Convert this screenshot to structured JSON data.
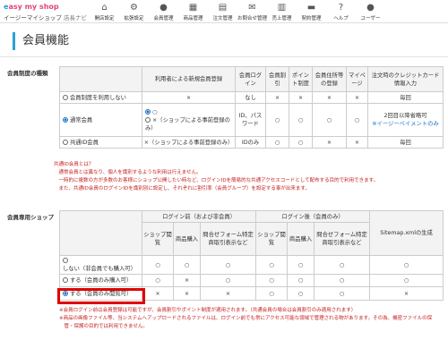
{
  "header": {
    "brand": "easy my shop",
    "brand_prefix": "e",
    "brand_rest": "asy my shop",
    "subtitle": "イージーマイショップ",
    "subtitle_shop": "店長ナビ",
    "nav": [
      {
        "icon": "home-icon",
        "glyph": "⌂",
        "label": "開店設定"
      },
      {
        "icon": "gear-icon",
        "glyph": "⚙",
        "label": "拡張設定"
      },
      {
        "icon": "user-icon",
        "glyph": "●",
        "label": "会員管理"
      },
      {
        "icon": "shop-icon",
        "glyph": "▦",
        "label": "商品管理"
      },
      {
        "icon": "document-icon",
        "glyph": "▤",
        "label": "注文管理"
      },
      {
        "icon": "mail-icon",
        "glyph": "✉",
        "label": "お問合せ管理"
      },
      {
        "icon": "chart-icon",
        "glyph": "▥",
        "label": "売上管理"
      },
      {
        "icon": "book-icon",
        "glyph": "▬",
        "label": "契約管理"
      },
      {
        "icon": "help-icon",
        "glyph": "?",
        "label": "ヘルプ"
      },
      {
        "icon": "user-menu-icon",
        "glyph": "●",
        "label": "ユーザー"
      }
    ]
  },
  "page_title": "会員機能",
  "section1": {
    "label": "会員制度の種類",
    "headers": [
      "利用者による新規会員登録",
      "会員ログイン",
      "会員割引",
      "ポイント制度",
      "会員住所等の登録",
      "マイページ",
      "注文時のクレジットカード情報入力"
    ],
    "rows": [
      {
        "name": "会員制度を利用しない",
        "checked": false,
        "cells": [
          "×",
          "なし",
          "×",
          "×",
          "×",
          "×",
          "毎回"
        ]
      },
      {
        "name": "通常会員",
        "checked": true,
        "reg_a": "○",
        "reg_b": "×（ショップによる事前登録のみ）",
        "cells": [
          "ID、パスワード",
          "○",
          "○",
          "○",
          "○"
        ],
        "credit_a": "2回目以降省略可",
        "credit_b": "※イージーペイメントのみ"
      },
      {
        "name": "共通ID会員",
        "checked": false,
        "cells": [
          "×（ショップによる事前登録のみ）",
          "IDのみ",
          "○",
          "○",
          "×",
          "×",
          "毎回"
        ]
      }
    ],
    "notes": [
      "共通ID会員とは？",
      "　通常会員とは異なり、個人を識別するような利用は行えません。",
      "　一時的に複数の方が多数のお客様にショップ公開したい時など、ログインIDを簡易的な共通アクセスコードとして配布する目的で利用できます。",
      "　また、共通ID会員のログインIDを識別別に設定し、それぞれに割引率（会員グループ）を設定する事が出来ます。"
    ]
  },
  "section2": {
    "label": "会員専用ショップ",
    "group_before": "ログイン前（および非会員）",
    "group_after": "ログイン後（会員のみ）",
    "sitemap_header": "Sitemap.xmlの生成",
    "sub_headers": [
      "ショップ閲覧",
      "商品購入",
      "問合せフォーム特定商取引表示など",
      "ショップ閲覧",
      "商品購入",
      "問合せフォーム特定商取引表示など"
    ],
    "rows": [
      {
        "name": "しない（非会員でも購入可）",
        "checked": false,
        "cells": [
          "○",
          "○",
          "○",
          "○",
          "○",
          "○",
          "○"
        ]
      },
      {
        "name": "する（会員のみ購入可）",
        "checked": false,
        "cells": [
          "○",
          "×",
          "○",
          "○",
          "○",
          "○",
          "○"
        ]
      },
      {
        "name": "する（会員のみ閲覧可）",
        "checked": true,
        "cells": [
          "×",
          "×",
          "×",
          "○",
          "○",
          "○",
          "×"
        ]
      }
    ],
    "notes": [
      "※会員ログイン前は会員登録は可能ですが、会員割引やポイント制度が適用されます。（共通会員の場合は会員割引のみ適用されます）",
      "※商品の画像ファイル等、当システムへアップロードされるファイルは、ログイン前でも常にアクセス可能な領域で管理される物があります。その為、機密ファイルの保",
      "　管・保護の目的では利用できません。"
    ]
  },
  "colors": {
    "accent": "#2d9fd8",
    "brand_pink": "#e0457b",
    "highlight_box": "#e00000",
    "note_red": "#c62020"
  }
}
